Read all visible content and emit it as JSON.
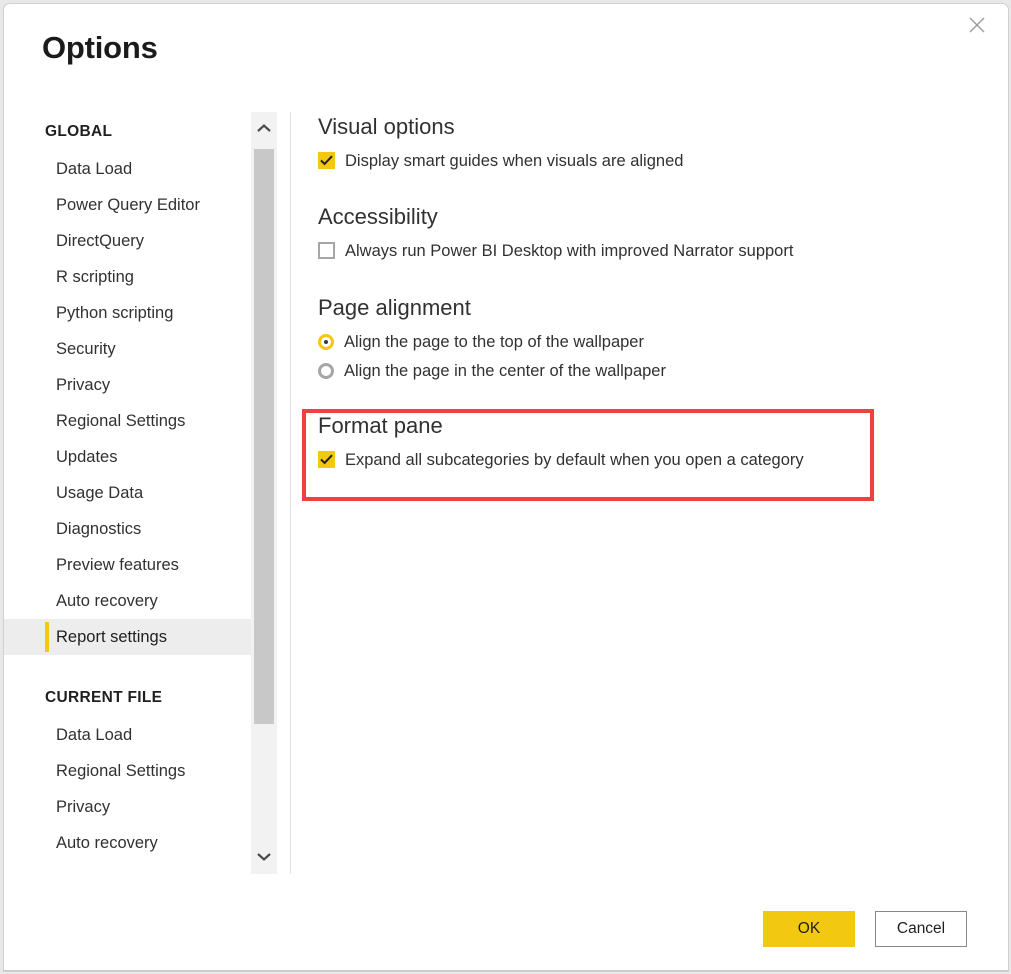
{
  "window": {
    "title": "Options",
    "close_icon": "close-icon"
  },
  "sidebar": {
    "groups": [
      {
        "label": "GLOBAL",
        "items": [
          {
            "label": "Data Load",
            "selected": false
          },
          {
            "label": "Power Query Editor",
            "selected": false
          },
          {
            "label": "DirectQuery",
            "selected": false
          },
          {
            "label": "R scripting",
            "selected": false
          },
          {
            "label": "Python scripting",
            "selected": false
          },
          {
            "label": "Security",
            "selected": false
          },
          {
            "label": "Privacy",
            "selected": false
          },
          {
            "label": "Regional Settings",
            "selected": false
          },
          {
            "label": "Updates",
            "selected": false
          },
          {
            "label": "Usage Data",
            "selected": false
          },
          {
            "label": "Diagnostics",
            "selected": false
          },
          {
            "label": "Preview features",
            "selected": false
          },
          {
            "label": "Auto recovery",
            "selected": false
          },
          {
            "label": "Report settings",
            "selected": true
          }
        ]
      },
      {
        "label": "CURRENT FILE",
        "items": [
          {
            "label": "Data Load",
            "selected": false
          },
          {
            "label": "Regional Settings",
            "selected": false
          },
          {
            "label": "Privacy",
            "selected": false
          },
          {
            "label": "Auto recovery",
            "selected": false
          }
        ]
      }
    ],
    "scrollbar": {
      "up_arrow_icon": "chevron-up-icon",
      "down_arrow_icon": "chevron-down-icon"
    }
  },
  "content": {
    "sections": {
      "visual_options": {
        "heading": "Visual options",
        "checkbox_label": "Display smart guides when visuals are aligned",
        "checked": true
      },
      "accessibility": {
        "heading": "Accessibility",
        "checkbox_label": "Always run Power BI Desktop with improved Narrator support",
        "checked": false
      },
      "page_alignment": {
        "heading": "Page alignment",
        "options": [
          {
            "label": "Align the page to the top of the wallpaper",
            "selected": true
          },
          {
            "label": "Align the page in the center of the wallpaper",
            "selected": false
          }
        ]
      },
      "format_pane": {
        "heading": "Format pane",
        "checkbox_label": "Expand all subcategories by default when you open a category",
        "checked": true,
        "highlighted": true
      }
    }
  },
  "footer": {
    "ok_label": "OK",
    "cancel_label": "Cancel"
  },
  "colors": {
    "accent_yellow": "#f2c811",
    "highlight_red": "#f0423c",
    "selected_nav_bg": "#ededed",
    "text_primary": "#323130",
    "scrollbar_thumb": "#c8c8c8",
    "scrollbar_track": "#f2f2f2"
  }
}
